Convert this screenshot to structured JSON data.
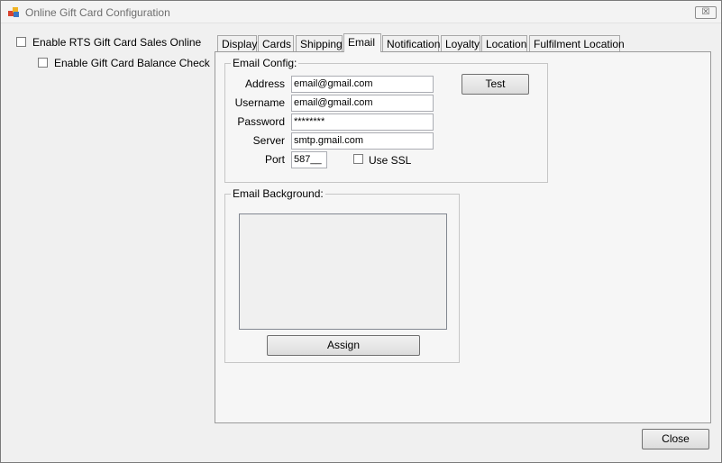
{
  "window": {
    "title": "Online Gift Card Configuration",
    "close_glyph": "☒"
  },
  "options": {
    "enable_rts_label": "Enable RTS Gift Card Sales Online",
    "enable_balance_label": "Enable Gift Card Balance Check",
    "enable_rts_checked": false,
    "enable_balance_checked": false
  },
  "tabs": [
    {
      "label": "Display"
    },
    {
      "label": "Cards"
    },
    {
      "label": "Shipping"
    },
    {
      "label": "Email"
    },
    {
      "label": "Notification"
    },
    {
      "label": "Loyalty"
    },
    {
      "label": "Location"
    },
    {
      "label": "Fulfilment Location"
    }
  ],
  "active_tab": "Email",
  "email_config": {
    "group_title": "Email Config:",
    "address_label": "Address",
    "address_value": "email@gmail.com",
    "username_label": "Username",
    "username_value": "email@gmail.com",
    "password_label": "Password",
    "password_value": "********",
    "server_label": "Server",
    "server_value": "smtp.gmail.com",
    "port_label": "Port",
    "port_value": "587__",
    "use_ssl_label": "Use SSL",
    "use_ssl_checked": false,
    "test_button": "Test"
  },
  "email_background": {
    "group_title": "Email Background:",
    "assign_button": "Assign"
  },
  "footer": {
    "close_button": "Close"
  }
}
